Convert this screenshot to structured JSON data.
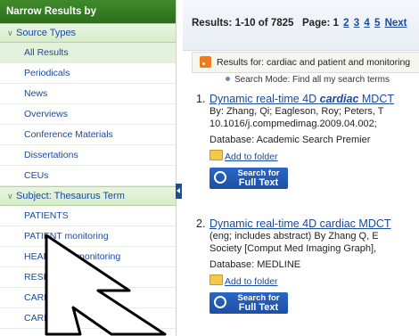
{
  "sidebar": {
    "title": "Narrow Results by",
    "source_types": {
      "label": "Source Types",
      "items": [
        {
          "label": "All Results"
        },
        {
          "label": "Periodicals"
        },
        {
          "label": "News"
        },
        {
          "label": "Overviews"
        },
        {
          "label": "Conference Materials"
        },
        {
          "label": "Dissertations"
        },
        {
          "label": "CEUs"
        }
      ]
    },
    "subject": {
      "label": "Subject: Thesaurus Term",
      "items": [
        {
          "label": "PATIENTS"
        },
        {
          "label": "PATIENT monitoring"
        },
        {
          "label": "HEART rate monitoring"
        },
        {
          "label": "RESEA"
        },
        {
          "label": "CARDIAC"
        },
        {
          "label": "CARDIAC"
        }
      ]
    }
  },
  "main": {
    "results_summary": "Results: 1-10 of 7825",
    "page_label": "Page: 1",
    "pages": [
      "2",
      "3",
      "4",
      "5"
    ],
    "next_label": "Next",
    "results_for": "Results for: cardiac and patient and monitoring",
    "search_mode": "Search Mode: Find all my search terms",
    "results": [
      {
        "number": "1.",
        "title_pre": "Dynamic real-time 4D ",
        "title_em": "cardiac",
        "title_post": " MDCT",
        "line1": "By: Zhang, Qi; Eagleson, Roy; Peters, T",
        "line2": "10.1016/j.compmedimag.2009.04.002;",
        "database": "Database: Academic Search Premier",
        "add_folder": "Add to folder",
        "fulltext_top": "Search for",
        "fulltext_bottom": "Full Text"
      },
      {
        "number": "2.",
        "title_pre": "Dynamic real-time 4D cardiac MDCT",
        "title_em": "",
        "title_post": "",
        "line1": "(eng; includes abstract) By Zhang Q, E",
        "line2": "Society [Comput Med Imaging Graph],",
        "database": "Database: MEDLINE",
        "add_folder": "Add to folder",
        "fulltext_top": "Search for",
        "fulltext_bottom": "Full Text"
      }
    ]
  },
  "colors": {
    "sidebar_header": "#2d6e1d",
    "section_bg": "#d6ecc9",
    "link": "#1a4aa0",
    "fulltext_button": "#1d4fa3",
    "rss": "#f07b1a"
  }
}
